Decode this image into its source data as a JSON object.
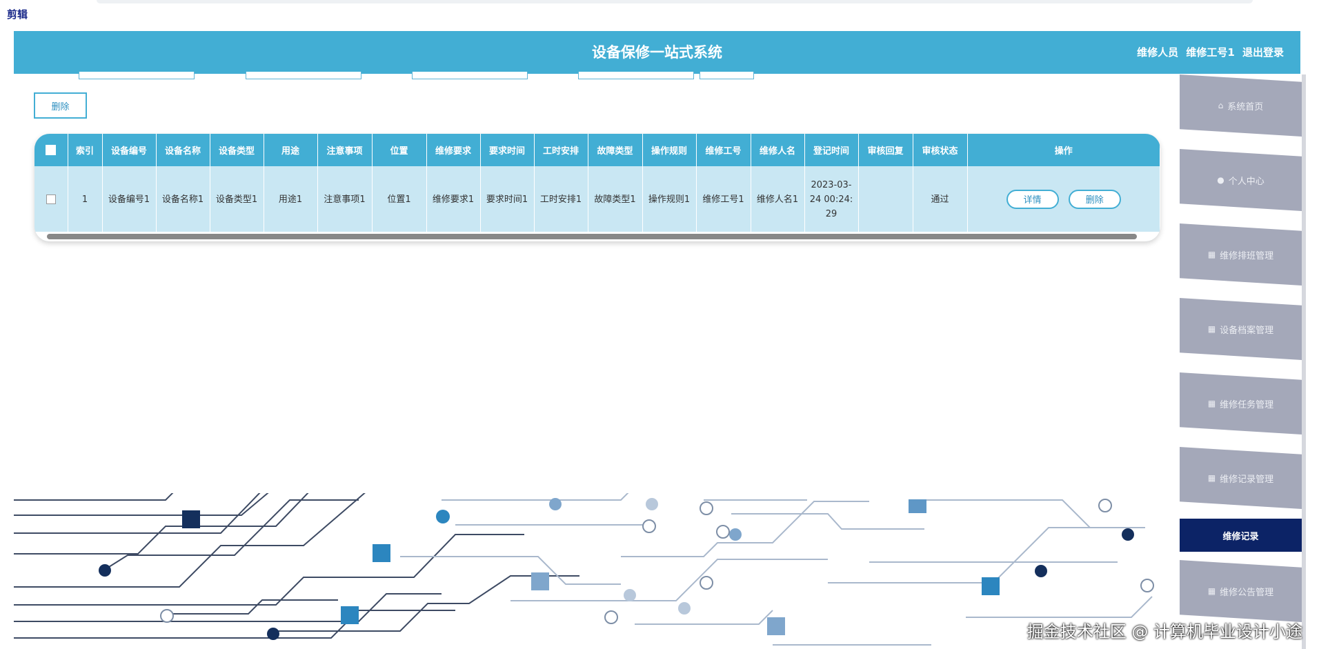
{
  "corner_label": "剪辑",
  "header": {
    "title": "设备保修一站式系统",
    "role": "维修人员",
    "username": "维修工号1",
    "logout": "退出登录"
  },
  "toolbar": {
    "delete_label": "删除"
  },
  "table": {
    "columns": [
      "索引",
      "设备编号",
      "设备名称",
      "设备类型",
      "用途",
      "注意事项",
      "位置",
      "维修要求",
      "要求时间",
      "工时安排",
      "故障类型",
      "操作规则",
      "维修工号",
      "维修人名",
      "登记时间",
      "审核回复",
      "审核状态",
      "操作"
    ],
    "rows": [
      {
        "index": "1",
        "device_no": "设备编号1",
        "device_name": "设备名称1",
        "device_type": "设备类型1",
        "usage": "用途1",
        "notes": "注意事项1",
        "location": "位置1",
        "repair_req": "维修要求1",
        "req_time": "要求时间1",
        "work_hours": "工时安排1",
        "fault_type": "故障类型1",
        "op_rules": "操作规则1",
        "worker_no": "维修工号1",
        "worker_name": "维修人名1",
        "reg_time": "2023-03-24 00:24:29",
        "audit_reply": "",
        "audit_status": "通过",
        "detail_label": "详情",
        "delete_label": "删除"
      }
    ]
  },
  "sidebar": {
    "items": [
      {
        "label": "系统首页",
        "icon": "home-icon"
      },
      {
        "label": "个人中心",
        "icon": "user-icon"
      },
      {
        "label": "维修排班管理",
        "icon": "grid-icon"
      },
      {
        "label": "设备档案管理",
        "icon": "grid-icon"
      },
      {
        "label": "维修任务管理",
        "icon": "grid-icon"
      },
      {
        "label": "维修记录管理",
        "icon": "grid-icon"
      },
      {
        "label": "维修记录",
        "icon": ""
      },
      {
        "label": "维修公告管理",
        "icon": "grid-icon"
      }
    ]
  },
  "watermark": "掘金技术社区 @ 计算机毕业设计小途",
  "colors": {
    "header": "#42aed4",
    "active_sidebar": "#0c2366",
    "sidebar": "#a4a8b9",
    "row": "#c9e7f3"
  }
}
